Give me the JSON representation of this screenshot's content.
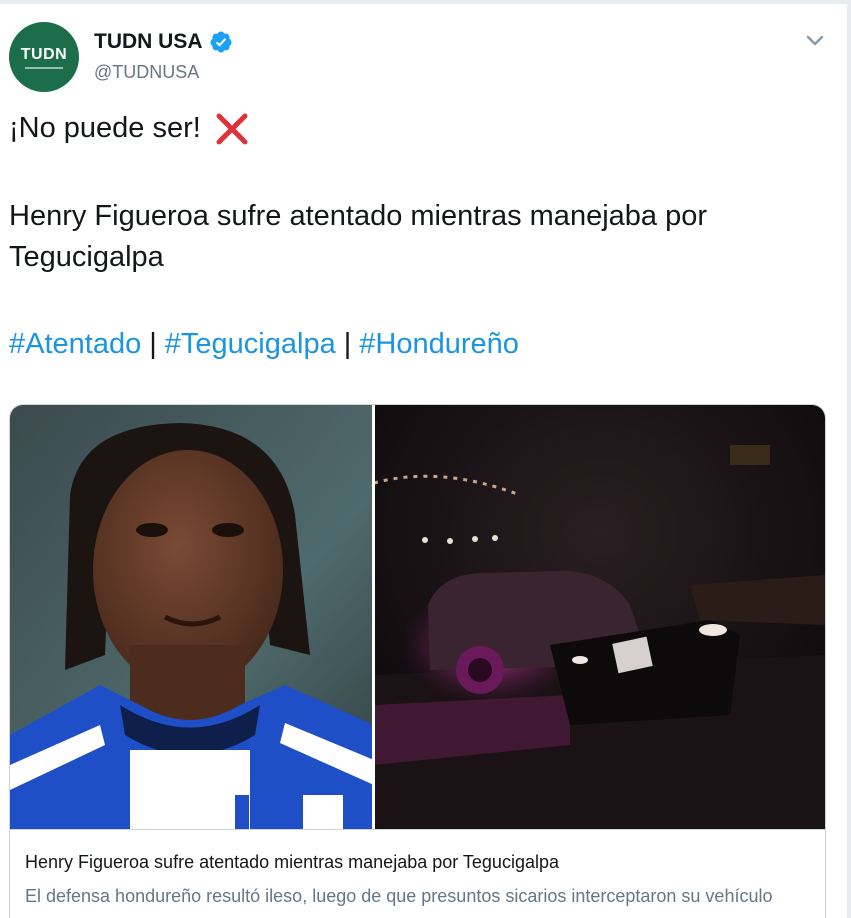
{
  "tweet": {
    "display_name": "TUDN USA",
    "handle": "@TUDNUSA",
    "verified": true,
    "avatar_text": "TUDN",
    "avatar_color": "#1b6e49",
    "text_line1": "¡No puede ser!",
    "line1_emoji_icon": "red-cross-mark-icon",
    "text_line2": "Henry Figueroa sufre atentado mientras manejaba por Tegucigalpa",
    "hashtags": [
      "#Atentado",
      "#Tegucigalpa",
      "#Hondureño"
    ],
    "hashtag_separator": "|",
    "hashtag_color": "#1b95e0"
  },
  "card": {
    "title": "Henry Figueroa sufre atentado mientras manejaba por Tegucigalpa",
    "description": "El defensa hondureño resultó ileso, luego de que presuntos sicarios interceptaron su vehículo",
    "left_image": "player-portrait-honduras-jersey",
    "right_image": "night-street-car-scene"
  },
  "icons": {
    "verified": "verified-badge-icon",
    "caret": "chevron-down-icon"
  }
}
